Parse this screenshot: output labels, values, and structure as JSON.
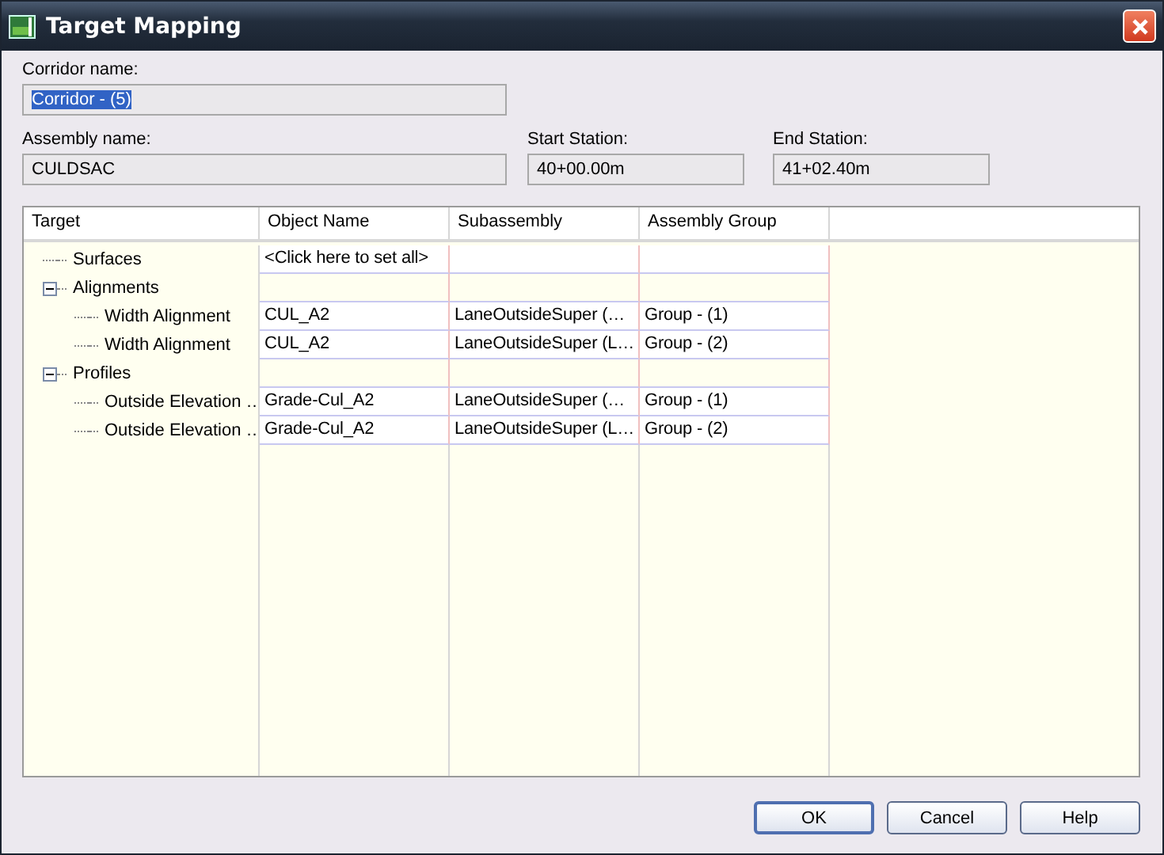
{
  "window": {
    "title": "Target Mapping"
  },
  "corridor": {
    "label": "Corridor name:",
    "value": "Corridor - (5)",
    "text_selected": true
  },
  "assembly": {
    "label": "Assembly name:",
    "value": "CULDSAC"
  },
  "start_station": {
    "label": "Start Station:",
    "value": "40+00.00m"
  },
  "end_station": {
    "label": "End Station:",
    "value": "41+02.40m"
  },
  "table": {
    "columns": [
      "Target",
      "Object Name",
      "Subassembly",
      "Assembly Group"
    ],
    "rows": [
      {
        "target": "Surfaces",
        "object_name": "<Click here to set all>"
      },
      {
        "target": "Alignments",
        "expanded": true,
        "children": [
          {
            "target": "Width Alignment",
            "object_name": "CUL_A2",
            "subassembly": "LaneOutsideSuper (…",
            "assembly_group": "Group - (1)"
          },
          {
            "target": "Width Alignment",
            "object_name": "CUL_A2",
            "subassembly": "LaneOutsideSuper (L…",
            "assembly_group": "Group - (2)"
          }
        ]
      },
      {
        "target": "Profiles",
        "expanded": true,
        "children": [
          {
            "target": "Outside Elevation …",
            "object_name": "Grade-Cul_A2",
            "subassembly": "LaneOutsideSuper (…",
            "assembly_group": "Group - (1)"
          },
          {
            "target": "Outside Elevation …",
            "object_name": "Grade-Cul_A2",
            "subassembly": "LaneOutsideSuper (L…",
            "assembly_group": "Group - (2)"
          }
        ]
      }
    ]
  },
  "buttons": [
    {
      "label": "OK",
      "default": true
    },
    {
      "label": "Cancel",
      "default": false
    },
    {
      "label": "Help",
      "default": false
    }
  ]
}
